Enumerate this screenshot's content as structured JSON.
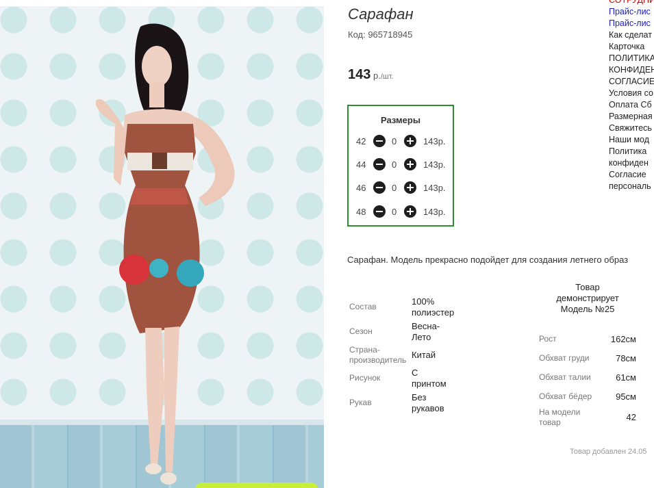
{
  "product": {
    "title": "Сарафан",
    "code": "Код: 965718945",
    "price_value": "143",
    "price_unit": " р.",
    "price_per": "/шт."
  },
  "sizes": {
    "header": "Размеры",
    "rows": [
      {
        "size": "42",
        "qty": "0",
        "price": "143р."
      },
      {
        "size": "44",
        "qty": "0",
        "price": "143р."
      },
      {
        "size": "46",
        "qty": "0",
        "price": "143р."
      },
      {
        "size": "48",
        "qty": "0",
        "price": "143р."
      }
    ]
  },
  "description": "Сарафан. Модель прекрасно подойдет для создания летнего образ",
  "specs": [
    {
      "label": "Состав",
      "value": "100%\nполиэстер"
    },
    {
      "label": "Сезон",
      "value": "Весна-\nЛето"
    },
    {
      "label": "Страна-\nпроизводитель",
      "value": "Китай"
    },
    {
      "label": "Рисунок",
      "value": "С\nпринтом"
    },
    {
      "label": "Рукав",
      "value": "Без\nрукавов"
    }
  ],
  "model_info": {
    "header": "Товар\nдемонстрирует\nМодель №25",
    "params": [
      {
        "label": "Рост",
        "value": "162см"
      },
      {
        "label": "Обхват груди",
        "value": "78см"
      },
      {
        "label": "Обхват талии",
        "value": "61см"
      },
      {
        "label": "Обхват бёдер",
        "value": "95см"
      },
      {
        "label": "На модели\nтовар",
        "value": "42"
      }
    ]
  },
  "added": "Товар добавлен 24.05",
  "sidebar": {
    "items": [
      {
        "text": "СОТРУДНИ",
        "color": "#d40000"
      },
      {
        "text": "Прайс-лис",
        "color": "#1a1acc"
      },
      {
        "text": "Прайс-лис",
        "color": "#1a1acc"
      },
      {
        "text": "Как сделат",
        "color": "#222222"
      },
      {
        "text": "Карточка",
        "color": "#222222"
      },
      {
        "text": "ПОЛИТИКА",
        "color": "#222222"
      },
      {
        "text": "КОНФИДЕН",
        "color": "#222222"
      },
      {
        "text": "СОГЛАСИЕ",
        "color": "#222222"
      },
      {
        "text": "Условия со",
        "color": "#222222"
      },
      {
        "text": "Оплата Сб",
        "color": "#222222"
      },
      {
        "text": "Размерная",
        "color": "#222222"
      },
      {
        "text": "Свяжитесь",
        "color": "#222222"
      },
      {
        "text": "Наши мод",
        "color": "#222222"
      },
      {
        "text": "Политика",
        "color": "#222222"
      },
      {
        "text": "конфиден",
        "color": "#222222"
      },
      {
        "text": "Согласие",
        "color": "#222222"
      },
      {
        "text": "персональ",
        "color": "#222222"
      }
    ]
  },
  "colors": {
    "sizes_border": "#2e8b2e",
    "sidebar_red": "#d40000",
    "sidebar_blue": "#1a1acc",
    "cart_button": "#c7ee3a"
  },
  "icons": [
    "minus-circle-icon",
    "plus-circle-icon"
  ]
}
